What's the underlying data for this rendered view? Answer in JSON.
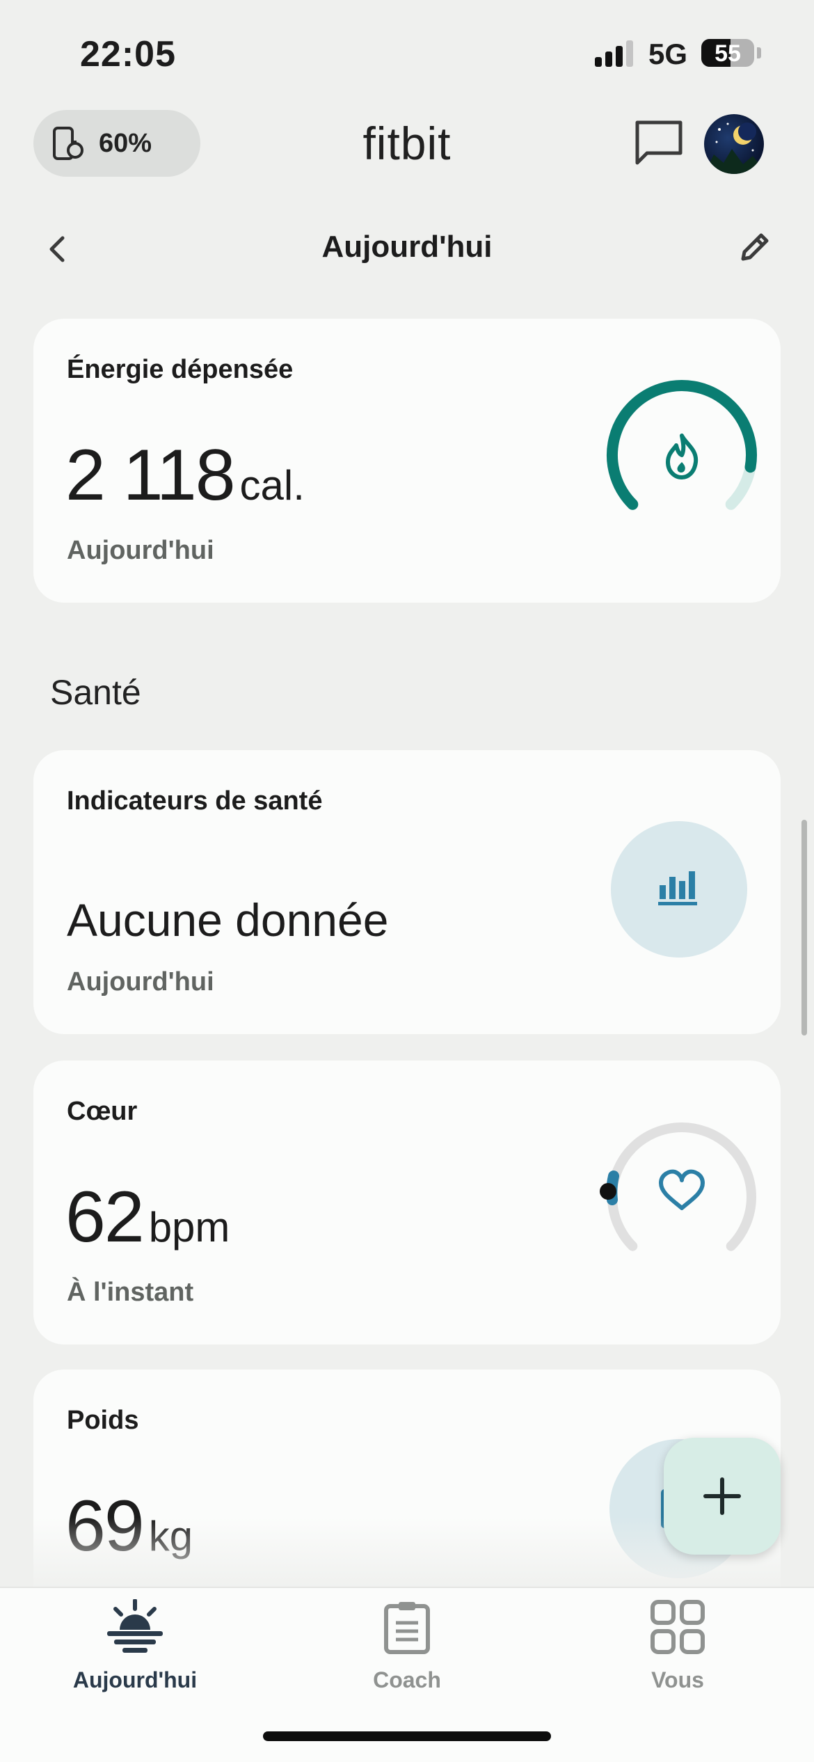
{
  "status_bar": {
    "time": "22:05",
    "network": "5G",
    "battery_level": "55",
    "battery_fraction": 0.55
  },
  "top_bar": {
    "device_battery": "60%",
    "app_title": "fitbit",
    "icons": [
      "device-icon",
      "chat-icon",
      "avatar"
    ]
  },
  "header": {
    "title": "Aujourd'hui",
    "icons": [
      "back-icon",
      "edit-icon"
    ]
  },
  "cards": {
    "energy": {
      "title": "Énergie dépensée",
      "value": "2 118",
      "unit": "cal.",
      "subtitle": "Aujourd'hui",
      "icon": "flame-icon",
      "progress": 0.87,
      "accent": "#0a7d72",
      "track": "#d5ebe7"
    },
    "section_label": "Santé",
    "health_metrics": {
      "title": "Indicateurs de santé",
      "value": "Aucune donnée",
      "subtitle": "Aujourd'hui",
      "icon": "bar-chart-icon",
      "accent": "#2b7fa6",
      "circle": "#d9e8ec"
    },
    "heart": {
      "title": "Cœur",
      "value": "62",
      "unit": "bpm",
      "subtitle": "À l'instant",
      "icon": "heart-icon",
      "accent": "#2b7fa6",
      "track": "#e0e0e0"
    },
    "weight": {
      "title": "Poids",
      "value": "69",
      "unit": "kg"
    }
  },
  "fab": {
    "icon": "plus-icon"
  },
  "bottom_nav": {
    "items": [
      {
        "label": "Aujourd'hui",
        "icon": "sunrise-icon",
        "active": true
      },
      {
        "label": "Coach",
        "icon": "clipboard-icon",
        "active": false
      },
      {
        "label": "Vous",
        "icon": "grid-icon",
        "active": false
      }
    ]
  }
}
